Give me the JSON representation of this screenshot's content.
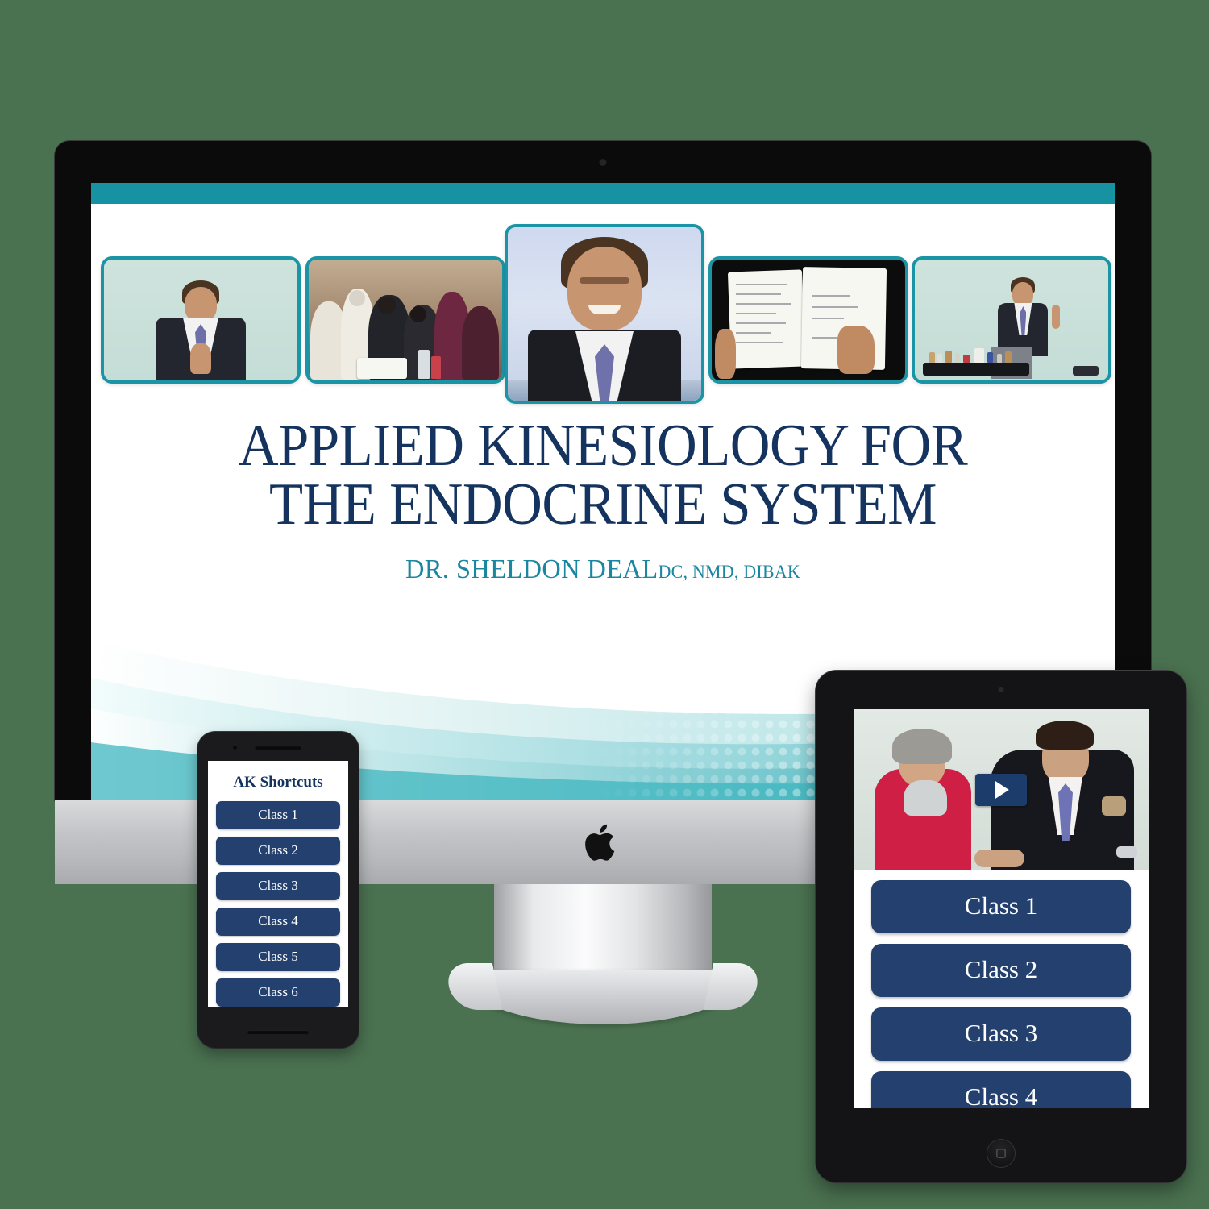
{
  "theme": {
    "background": "#4a7150",
    "slide_accent_teal": "#1792a3",
    "title_navy": "#14335f",
    "subtitle_teal": "#1b86a0",
    "button_navy": "#24406e",
    "photo_border": "#1b95a6"
  },
  "slide": {
    "title_line_1": "APPLIED KINESIOLOGY FOR",
    "title_line_2": "THE ENDOCRINE SYSTEM",
    "presenter_name": "DR. SHELDON DEAL",
    "presenter_credentials": "DC, NMD, DIBAK",
    "photos": [
      {
        "name": "speaker-hands-together",
        "caption": ""
      },
      {
        "name": "seminar-audience",
        "caption": ""
      },
      {
        "name": "sheldon-deal-portrait",
        "caption": ""
      },
      {
        "name": "handwritten-notebook",
        "caption": ""
      },
      {
        "name": "speaker-with-supplements-table",
        "caption": ""
      }
    ]
  },
  "phone": {
    "app_title": "AK Shortcuts",
    "buttons": [
      "Class 1",
      "Class 2",
      "Class 3",
      "Class 4",
      "Class 5",
      "Class 6"
    ]
  },
  "tablet": {
    "video": {
      "name": "muscle-testing-demo",
      "play_icon": "play-icon"
    },
    "buttons": [
      "Class 1",
      "Class 2",
      "Class 3",
      "Class 4"
    ]
  },
  "devices": {
    "desktop_brand_icon": "apple-logo-icon",
    "tablet_home_icon": "home-button-icon"
  }
}
